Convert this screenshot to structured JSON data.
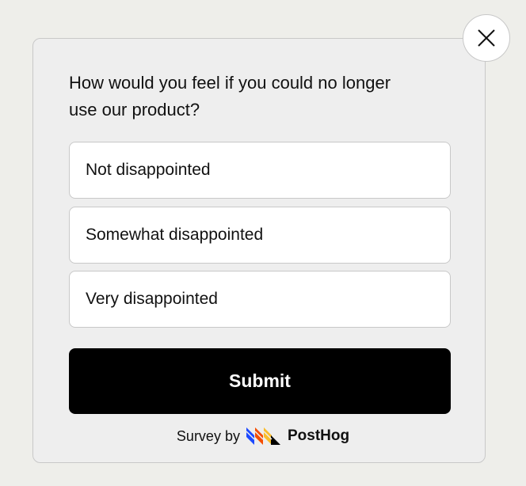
{
  "survey": {
    "question": "How would you feel if you could no longer use our product?",
    "options": [
      {
        "label": "Not disappointed"
      },
      {
        "label": "Somewhat disappointed"
      },
      {
        "label": "Very disappointed"
      }
    ],
    "submit_label": "Submit",
    "footer_prefix": "Survey by",
    "brand": "PostHog",
    "close_icon": "close-icon",
    "colors": {
      "button": "#000000",
      "logo_blue": "#1d4aff",
      "logo_orange": "#f54e00",
      "logo_yellow": "#f9bd2b"
    }
  }
}
